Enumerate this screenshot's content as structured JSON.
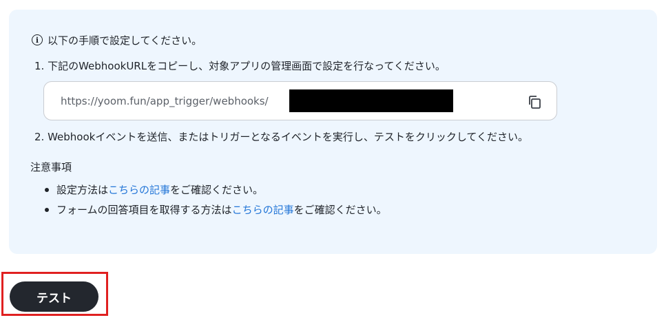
{
  "instructions": {
    "header": "以下の手順で設定してください。",
    "step1": "1. 下記のWebhookURLをコピーし、対象アプリの管理画面で設定を行なってください。",
    "webhook_url": "https://yoom.fun/app_trigger/webhooks/",
    "step2": "2. Webhookイベントを送信、またはトリガーとなるイベントを実行し、テストをクリックしてください。"
  },
  "notes": {
    "title": "注意事項",
    "items": [
      {
        "prefix": "設定方法は",
        "link": "こちらの記事",
        "suffix": "をご確認ください。"
      },
      {
        "prefix": "フォームの回答項目を取得する方法は",
        "link": "こちらの記事",
        "suffix": "をご確認ください。"
      }
    ]
  },
  "actions": {
    "test_label": "テスト"
  },
  "colors": {
    "panel_bg": "#eef6fe",
    "link": "#2275d7",
    "button_bg": "#23272e",
    "highlight": "#e02020"
  },
  "icons": {
    "info": "info-circle-icon",
    "copy": "copy-icon"
  }
}
